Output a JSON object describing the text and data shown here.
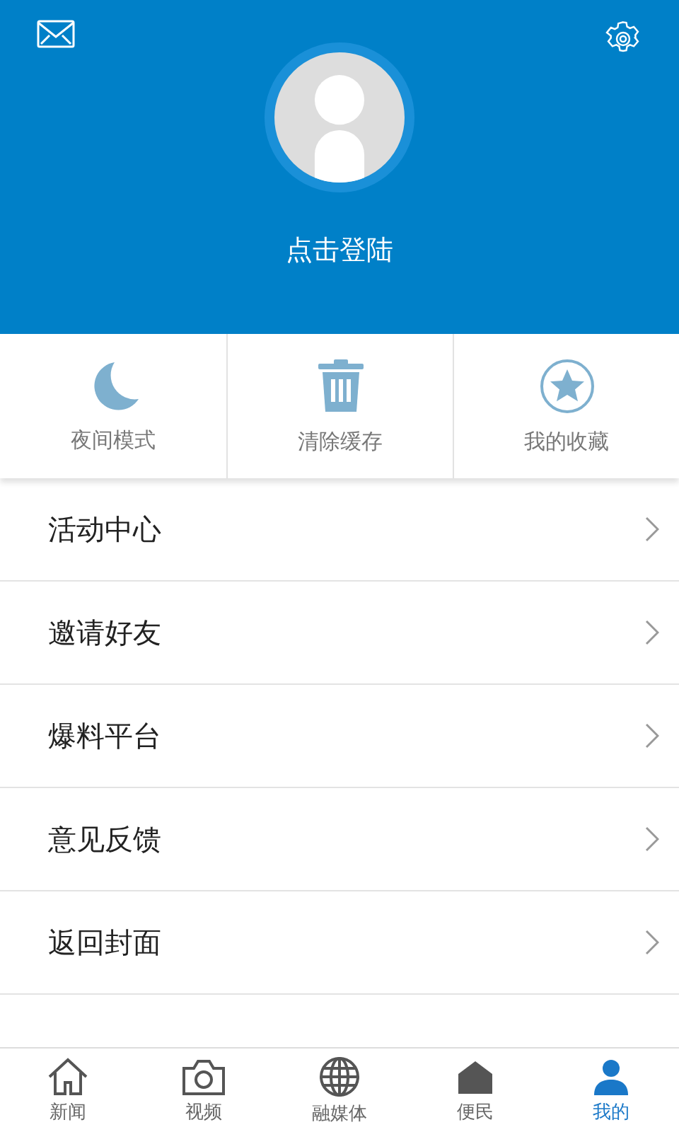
{
  "header": {
    "login_label": "点击登陆"
  },
  "quick_actions": [
    {
      "kind": "moon",
      "label": "夜间模式"
    },
    {
      "kind": "trash",
      "label": "清除缓存"
    },
    {
      "kind": "star",
      "label": "我的收藏"
    }
  ],
  "menu": [
    {
      "label": "活动中心"
    },
    {
      "label": "邀请好友"
    },
    {
      "label": "爆料平台"
    },
    {
      "label": "意见反馈"
    },
    {
      "label": "返回封面"
    }
  ],
  "tabs": [
    {
      "kind": "home",
      "label": "新闻",
      "selected": false
    },
    {
      "kind": "camera",
      "label": "视频",
      "selected": false
    },
    {
      "kind": "globe",
      "label": "融媒体",
      "selected": false
    },
    {
      "kind": "shop",
      "label": "便民",
      "selected": false
    },
    {
      "kind": "person",
      "label": "我的",
      "selected": true
    }
  ]
}
